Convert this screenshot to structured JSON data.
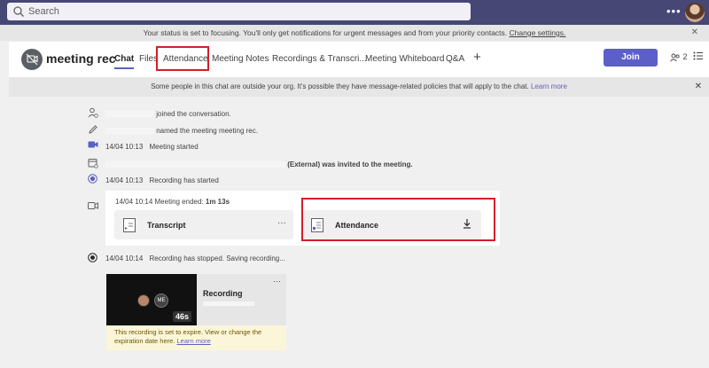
{
  "search": {
    "placeholder": "Search"
  },
  "topbar": {
    "more_label": "•••"
  },
  "focus_banner": {
    "text": "Your status is set to focusing. You'll only get notifications for urgent messages and from your priority contacts.",
    "link": "Change settings.",
    "close": "✕"
  },
  "header": {
    "title": "meeting rec",
    "tabs": [
      {
        "label": "Chat"
      },
      {
        "label": "Files"
      },
      {
        "label": "Attendance"
      },
      {
        "label": "Meeting Notes"
      },
      {
        "label": "Recordings & Transcri..."
      },
      {
        "label": "Meeting Whiteboard"
      },
      {
        "label": "Q&A"
      }
    ],
    "add_tab": "+",
    "join_label": "Join",
    "participants_count": "2"
  },
  "org_banner": {
    "text": "Some people in this chat are outside your org. It's possible they have message-related policies that will apply to the chat.",
    "link": "Learn more",
    "close": "✕"
  },
  "messages": [
    {
      "time": "",
      "text": "joined the conversation."
    },
    {
      "time": "",
      "text": "named the meeting meeting rec."
    },
    {
      "time": "14/04 10:13",
      "text": "Meeting started"
    },
    {
      "time": "",
      "text": "(External) was invited to the meeting."
    },
    {
      "time": "14/04 10:13",
      "text": "Recording has started"
    },
    {
      "time": "14/04 10:14",
      "text": "Recording has stopped. Saving recording..."
    }
  ],
  "meeting_card": {
    "time": "14/04 10:14",
    "ended_text": "Meeting ended:",
    "duration": "1m 13s",
    "transcript_label": "Transcript",
    "transcript_more": "···",
    "attendance_label": "Attendance"
  },
  "recording": {
    "title": "Recording",
    "duration": "46s",
    "avatar_initials": "ME",
    "more": "···",
    "expire_text": "This recording is set to expire. View or change the expiration date here.",
    "expire_link": "Learn more"
  },
  "colors": {
    "brand": "#5b5fc7",
    "topbar": "#464775",
    "highlight": "#d11f2a"
  }
}
